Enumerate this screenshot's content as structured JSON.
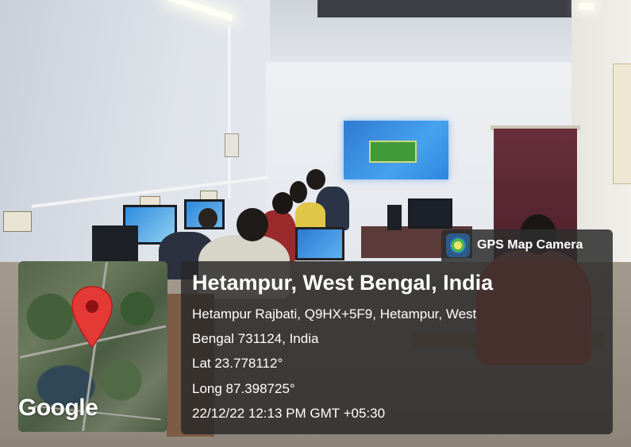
{
  "overlay": {
    "app_badge": "GPS Map Camera",
    "app_icon": "gps-map-camera-icon",
    "location_title": "Hetampur, West Bengal, India",
    "address_line1": "Hetampur Rajbati, Q9HX+5F9, Hetampur, West",
    "address_line2": "Bengal 731124, India",
    "latitude": "Lat 23.778112°",
    "longitude": "Long 87.398725°",
    "timestamp": "22/12/22 12:13 PM GMT +05:30",
    "map_attribution": "Google",
    "map_marker_icon": "map-pin-icon"
  },
  "colors": {
    "panel_bg": "#282828",
    "text": "#ffffff",
    "pin": "#e53935"
  }
}
